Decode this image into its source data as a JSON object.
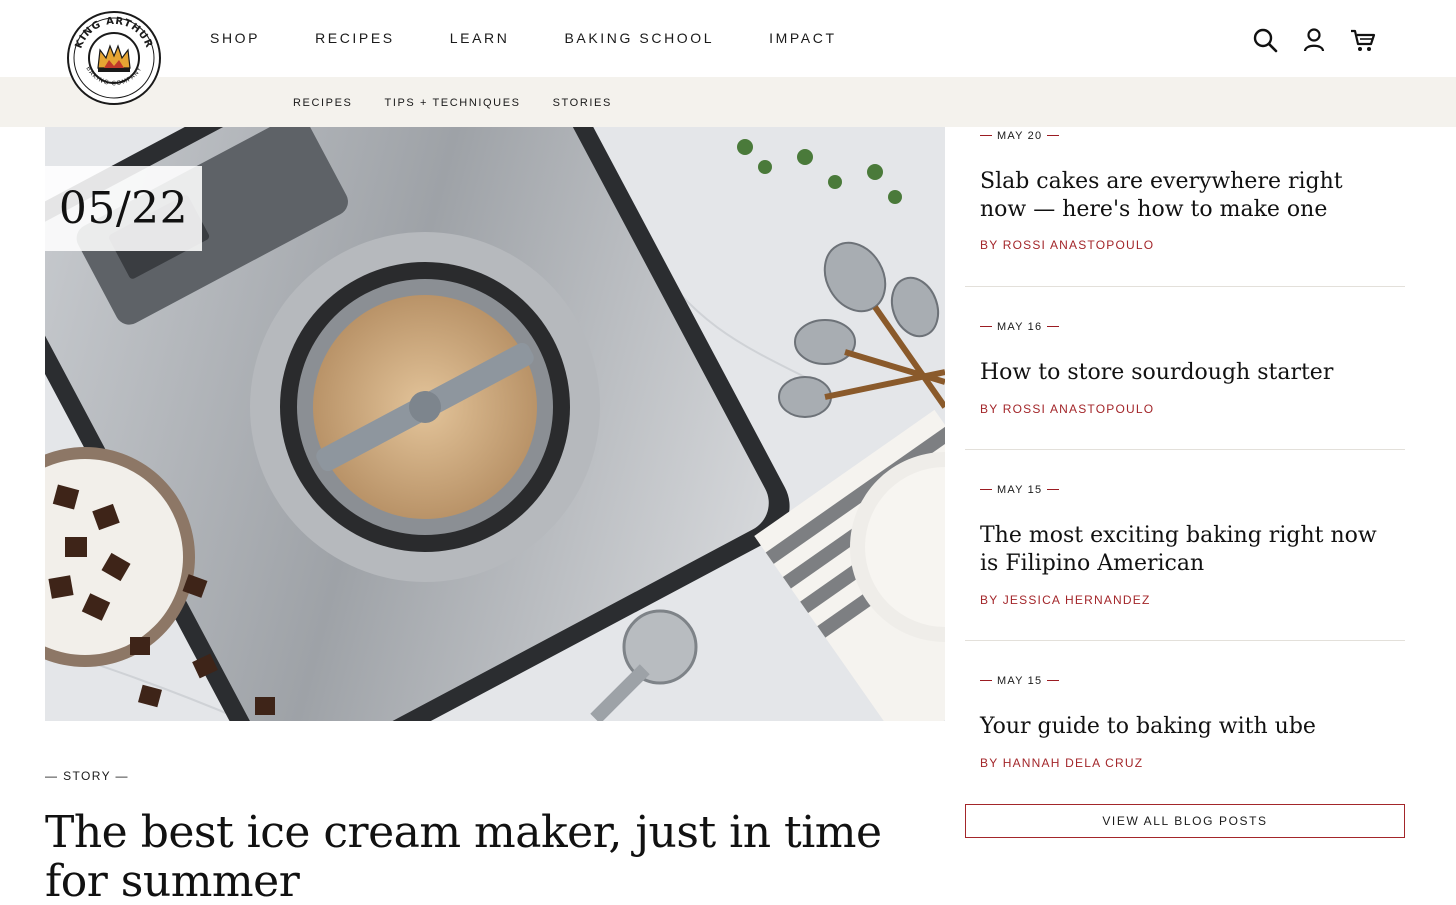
{
  "brand": {
    "logo_text_top": "KING ARTHUR",
    "logo_text_bottom": "BAKING COMPANY"
  },
  "nav": {
    "main": [
      "SHOP",
      "RECIPES",
      "LEARN",
      "BAKING SCHOOL",
      "IMPACT"
    ],
    "sub": [
      "RECIPES",
      "TIPS + TECHNIQUES",
      "STORIES"
    ],
    "icons": [
      "search-icon",
      "account-icon",
      "cart-icon"
    ]
  },
  "featured": {
    "date": "05/22",
    "tag": "— STORY —",
    "title": "The best ice cream maker, just in time for summer"
  },
  "posts": [
    {
      "date": "MAY 20",
      "title": "Slab cakes are everywhere right now — here's how to make one",
      "author": "BY ROSSI ANASTOPOULO"
    },
    {
      "date": "MAY 16",
      "title": "How to store sourdough starter",
      "author": "BY ROSSI ANASTOPOULO"
    },
    {
      "date": "MAY 15",
      "title": "The most exciting baking right now is Filipino American",
      "author": "BY JESSICA HERNANDEZ"
    },
    {
      "date": "MAY 15",
      "title": "Your guide to baking with ube",
      "author": "BY HANNAH DELA CRUZ"
    }
  ],
  "view_all_label": "VIEW ALL BLOG POSTS",
  "colors": {
    "accent": "#a3262a",
    "subbar_bg": "#f4f2ed",
    "text": "#1a1a1a"
  }
}
